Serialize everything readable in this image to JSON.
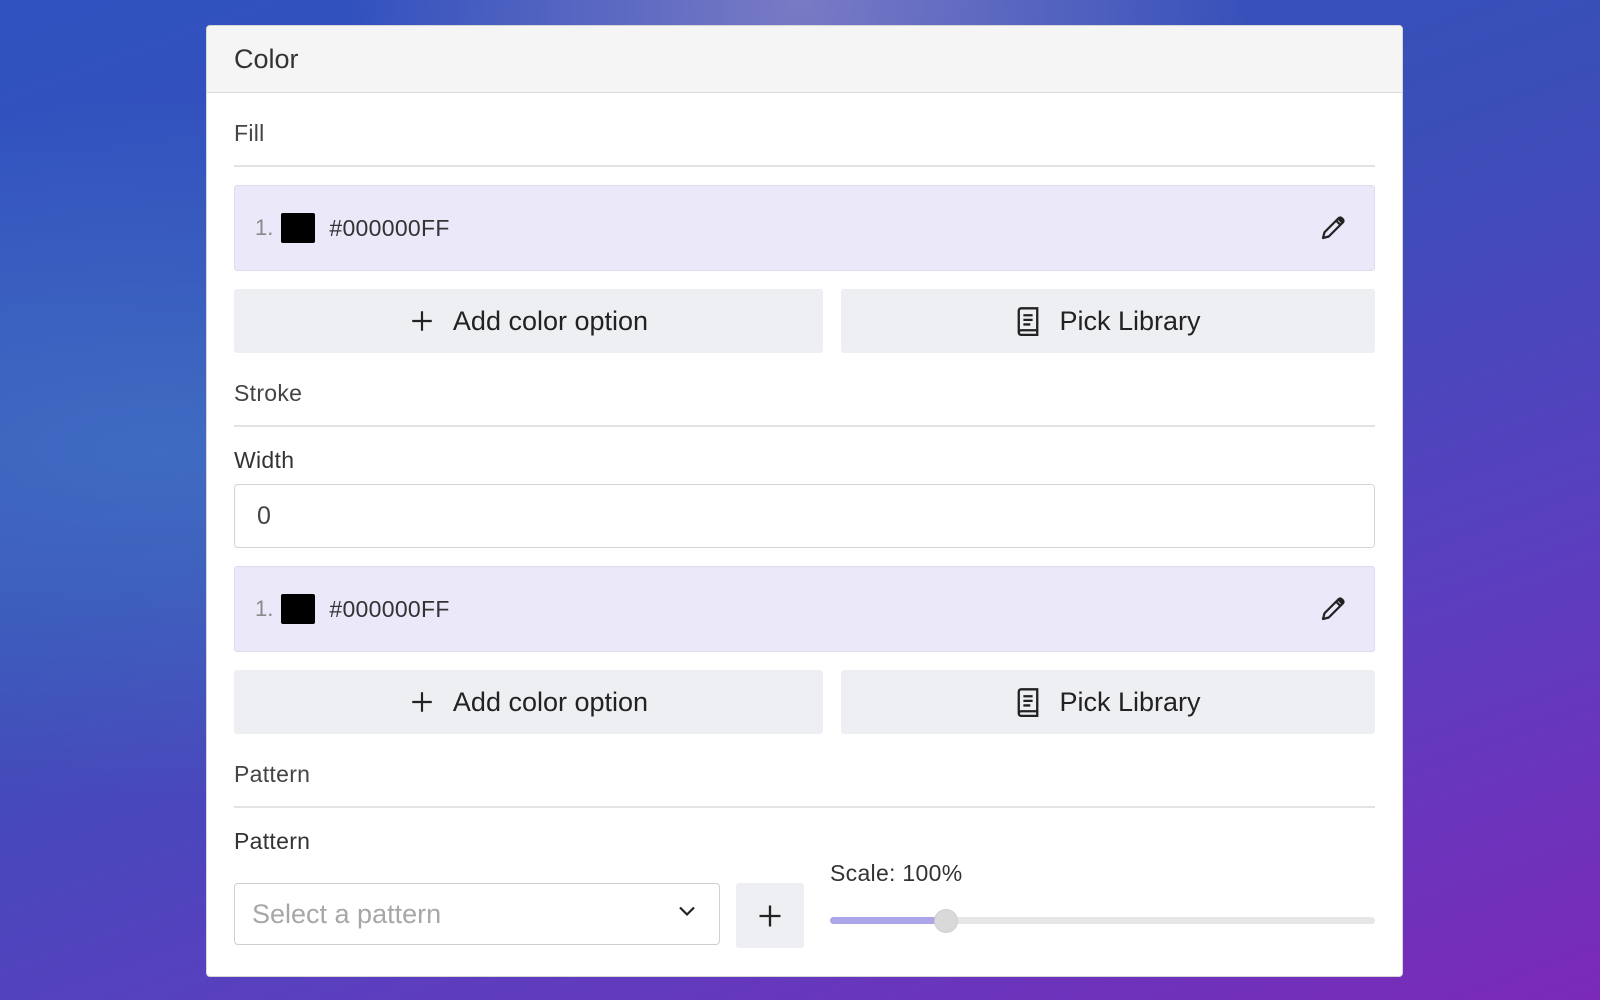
{
  "panel": {
    "title": "Color"
  },
  "fill": {
    "section_title": "Fill",
    "colors": [
      {
        "index": "1.",
        "hex": "#000000FF"
      }
    ],
    "add_label": "Add color option",
    "library_label": "Pick Library"
  },
  "stroke": {
    "section_title": "Stroke",
    "width_label": "Width",
    "width_value": "0",
    "colors": [
      {
        "index": "1.",
        "hex": "#000000FF"
      }
    ],
    "add_label": "Add color option",
    "library_label": "Pick Library"
  },
  "pattern": {
    "section_title": "Pattern",
    "field_label": "Pattern",
    "placeholder": "Select a pattern",
    "scale_label": "Scale: 100%",
    "scale_fraction": 0.2
  },
  "colors": {
    "accent": "#aca6e8",
    "row_bg": "#ebe8f9"
  },
  "icons": [
    "plus-icon",
    "book-icon",
    "pencil-icon",
    "chevron-down-icon"
  ]
}
